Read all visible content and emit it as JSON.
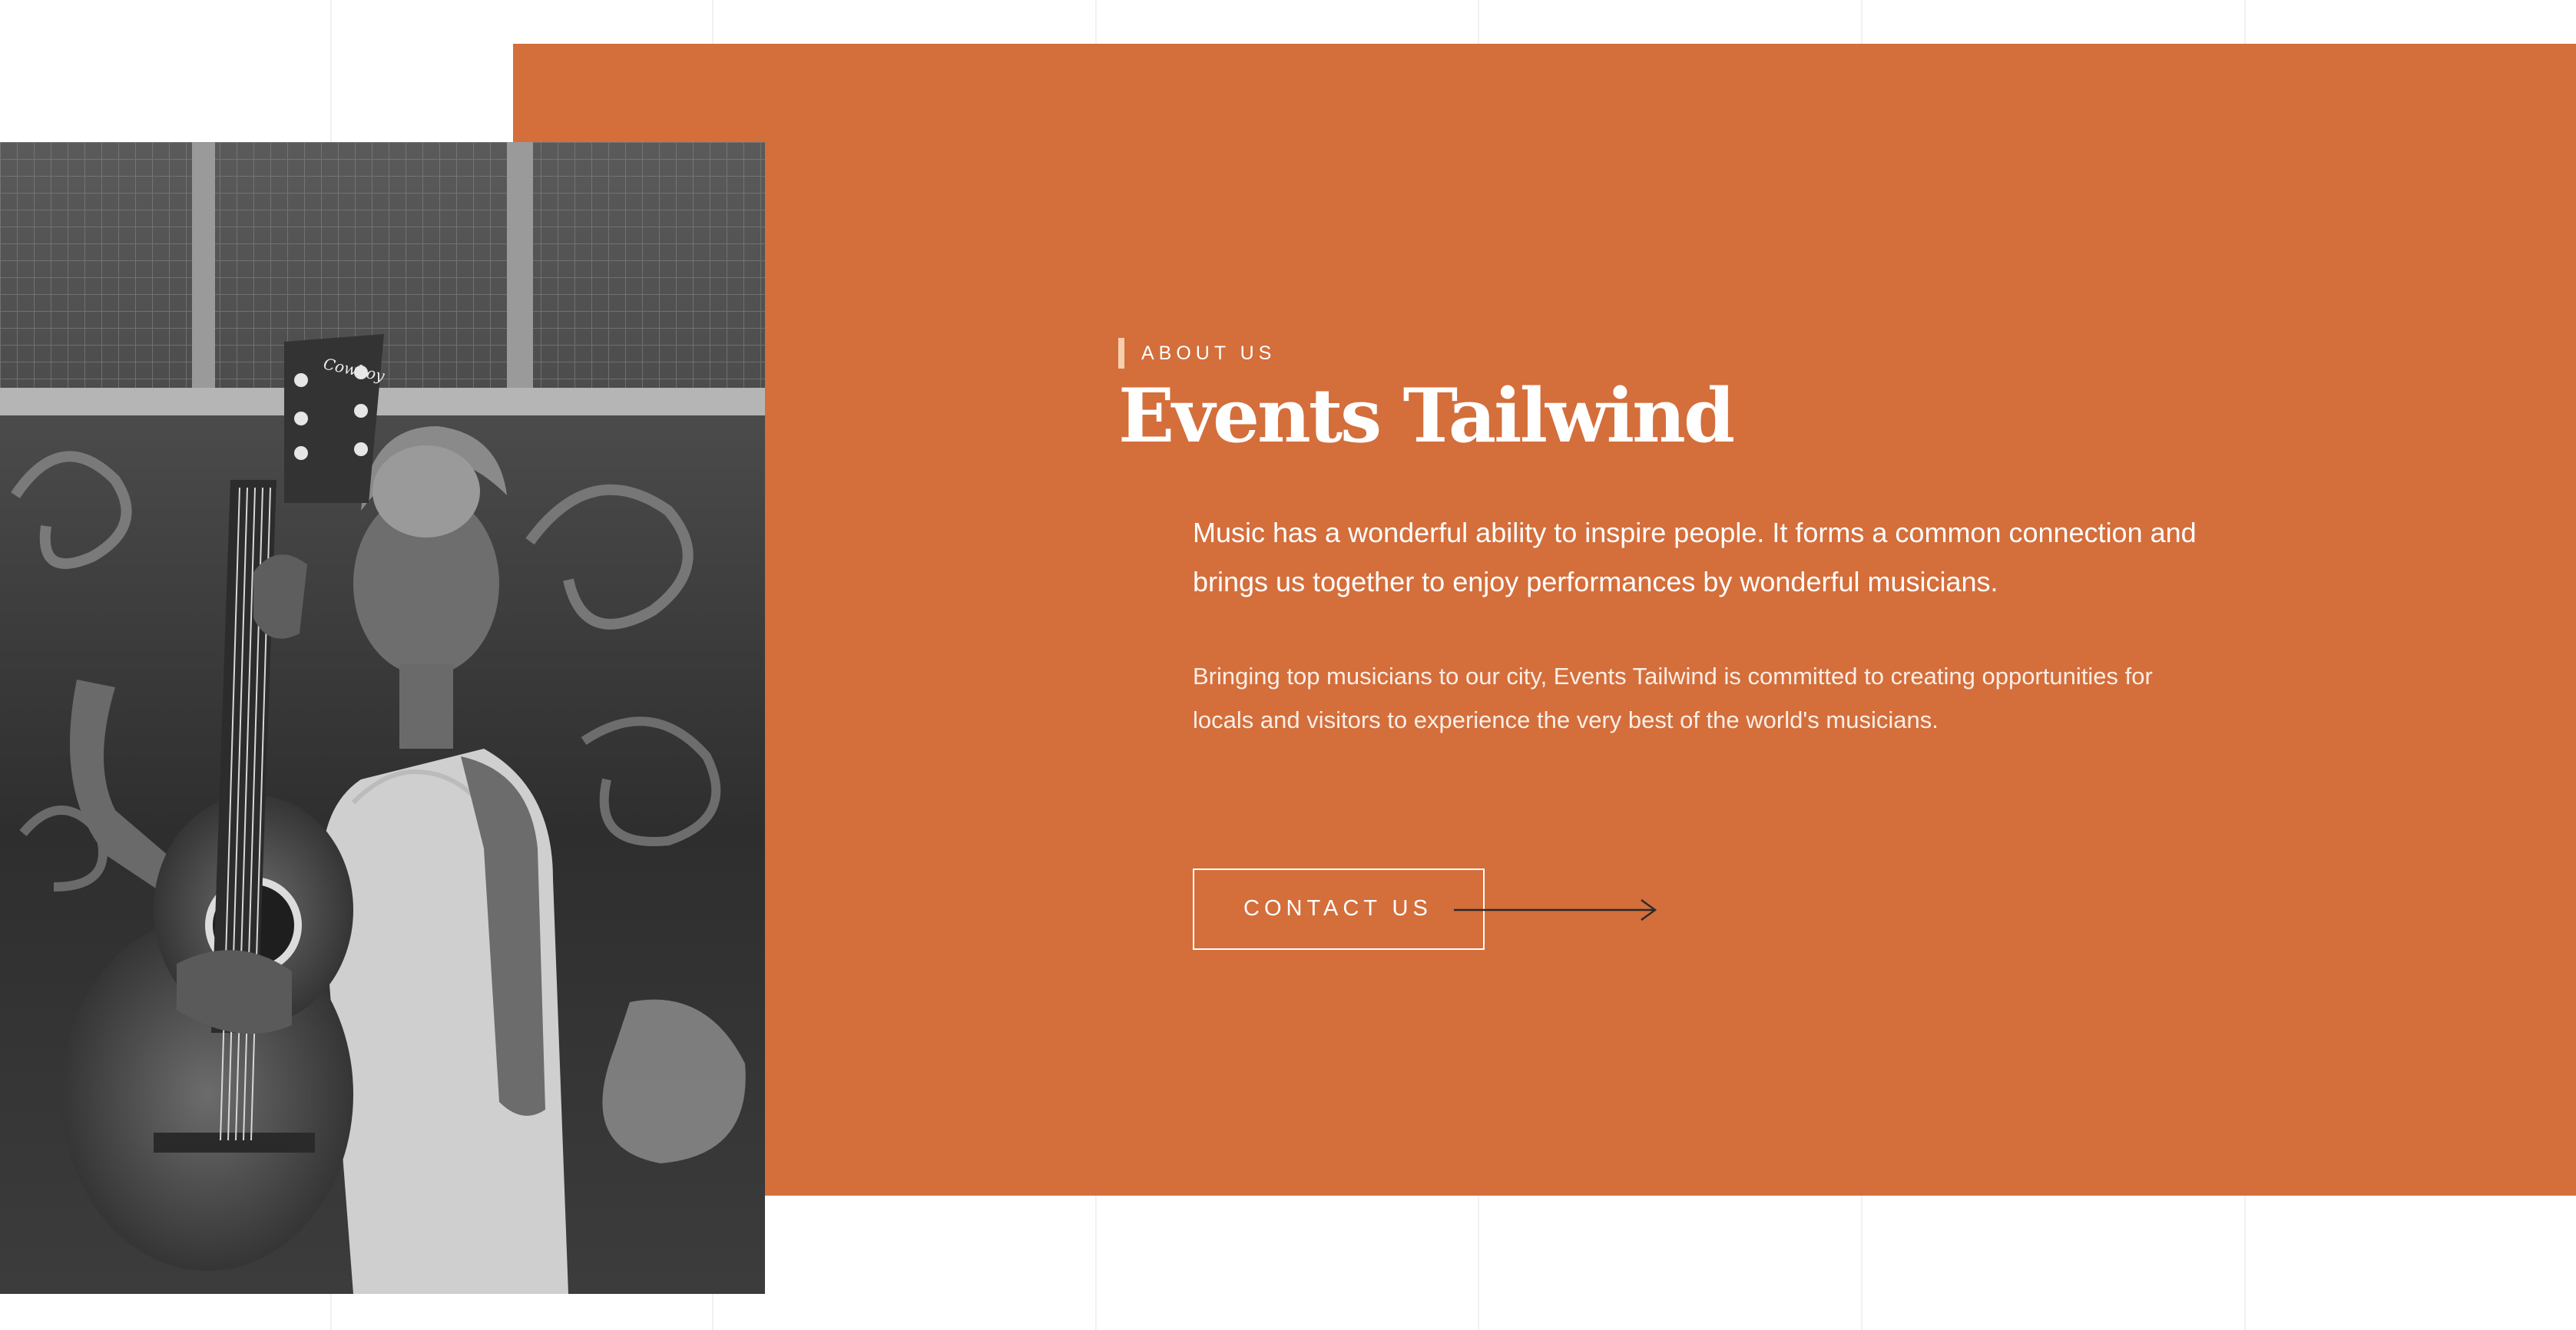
{
  "about": {
    "eyebrow": "ABOUT US",
    "title": "Events Tailwind",
    "lead": "Music has a wonderful ability to inspire people. It forms a common connection and brings us together to enjoy performances by wonderful musicians.",
    "paragraph": "Bringing top musicians to our city, Events Tailwind is committed to creating opportunities for locals and visitors to experience the very best of the world's musicians.",
    "cta_label": "CONTACT US"
  },
  "photo": {
    "alt": "Woman holding an acoustic guitar in front of a graffiti wall",
    "guitar_brand": "Cowboy"
  },
  "colors": {
    "accent": "#d46e3b",
    "accent_bar": "#f7cfae",
    "background": "#ffffff"
  },
  "icons": {
    "cta_arrow": "arrow-right-icon"
  }
}
